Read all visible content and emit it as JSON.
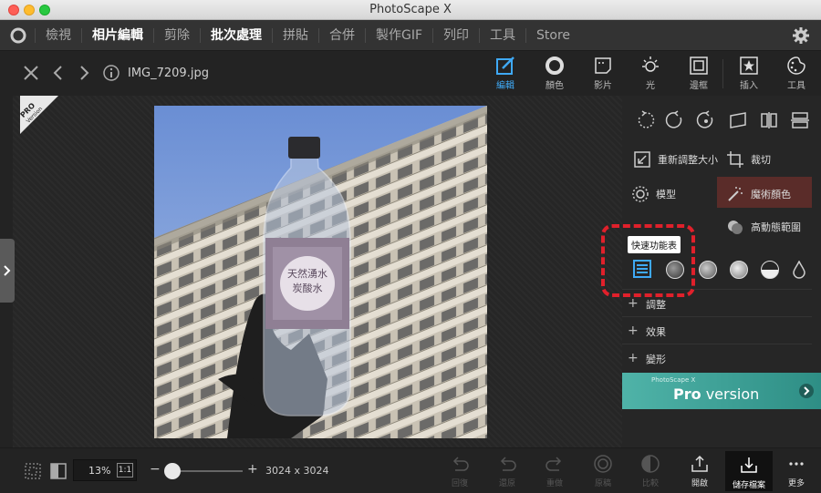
{
  "window": {
    "title": "PhotoScape X"
  },
  "nav": {
    "items": [
      "檢視",
      "相片編輯",
      "剪除",
      "批次處理",
      "拼貼",
      "合併",
      "製作GIF",
      "列印",
      "工具",
      "Store"
    ],
    "active_index": [
      1,
      3
    ]
  },
  "editor": {
    "filename": "IMG_7209.jpg"
  },
  "tool_tabs": [
    {
      "label": "編輯",
      "icon": "edit-icon"
    },
    {
      "label": "顏色",
      "icon": "color-icon"
    },
    {
      "label": "影片",
      "icon": "film-icon"
    },
    {
      "label": "光",
      "icon": "light-icon"
    },
    {
      "label": "邊框",
      "icon": "frame-icon"
    },
    {
      "label": "插入",
      "icon": "insert-icon"
    },
    {
      "label": "工具",
      "icon": "tools-icon"
    }
  ],
  "panel": {
    "resize": "重新調整大小",
    "crop": "裁切",
    "mosaic": "模型",
    "magic_color": "魔術顏色",
    "hdr": "高動態範圍",
    "quick_tooltip": "快速功能表",
    "adjust": "調整",
    "effects": "效果",
    "transform": "變形",
    "pro_small": "PhotoScape X",
    "pro_big_a": "Pro",
    "pro_big_b": " version"
  },
  "badge": {
    "line1": "PRO",
    "line2": "Version"
  },
  "bottom": {
    "zoom": "13%",
    "zoom_fit": "1:1",
    "dimensions": "3024 x 3024",
    "undo": "回復",
    "undo_all": "還原",
    "redo": "重做",
    "original": "原稿",
    "compare": "比較",
    "open": "開啟",
    "save": "儲存檔案",
    "more": "更多"
  },
  "colors": {
    "accent": "#3fa9f5",
    "highlight": "#e0202b",
    "pro_banner": "#4fb3a8"
  }
}
